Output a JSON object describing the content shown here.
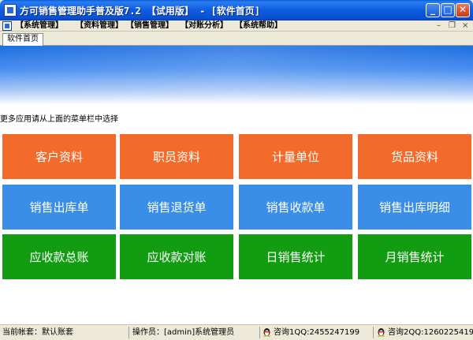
{
  "window": {
    "title": "方可销售管理助手普及版7.2 【试用版】 - [软件首页]",
    "buttons": {
      "minimize": "_",
      "maximize": "□",
      "close": "✕"
    }
  },
  "menu": {
    "items": [
      "【系统管理】",
      "【资料管理】",
      "【销售管理】",
      "【对账分析】",
      "【系统帮助】"
    ],
    "mdi_buttons": {
      "minimize": "–",
      "restore": "❐",
      "close": "×"
    }
  },
  "tabs": [
    "软件首页"
  ],
  "hint": "更多应用请从上面的菜单栏中选择",
  "tiles": [
    {
      "label": "客户资料",
      "color": "orange"
    },
    {
      "label": "职员资料",
      "color": "orange"
    },
    {
      "label": "计量单位",
      "color": "orange"
    },
    {
      "label": "货品资料",
      "color": "orange"
    },
    {
      "label": "销售出库单",
      "color": "blue"
    },
    {
      "label": "销售退货单",
      "color": "blue"
    },
    {
      "label": "销售收款单",
      "color": "blue"
    },
    {
      "label": "销售出库明细",
      "color": "blue"
    },
    {
      "label": "应收款总账",
      "color": "green"
    },
    {
      "label": "应收款对账",
      "color": "green"
    },
    {
      "label": "日销售统计",
      "color": "green"
    },
    {
      "label": "月销售统计",
      "color": "green"
    }
  ],
  "status": {
    "account": "当前帐套：默认账套",
    "operator": "操作员：[admin]系统管理员",
    "qq1": "咨询1QQ:2455247199",
    "qq2": "咨询2QQ:1260225419"
  },
  "colors": {
    "orange": "#f26b2a",
    "blue": "#3a8ee8",
    "green": "#129c12",
    "titlebar": "#0a5fd8"
  }
}
